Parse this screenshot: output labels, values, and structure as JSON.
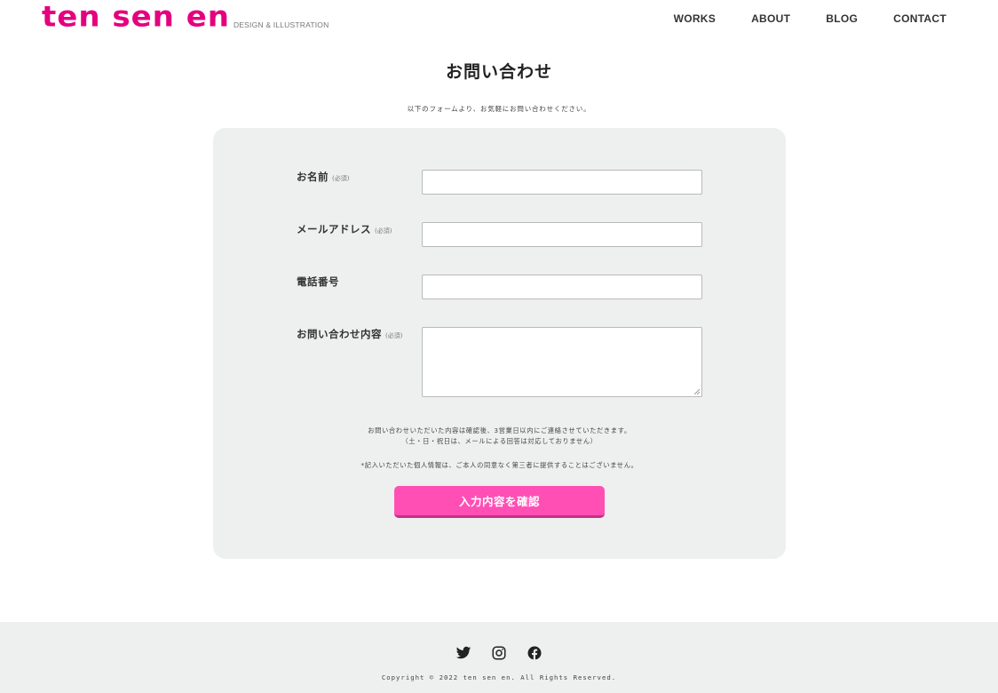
{
  "header": {
    "logo_text": "ten sen en",
    "logo_tagline": "DESIGN & ILLUSTRATION",
    "nav": [
      "WORKS",
      "ABOUT",
      "BLOG",
      "CONTACT"
    ]
  },
  "colors": {
    "brand": "#e4007f",
    "button": "#ff4fb4",
    "panel": "#eef0f0"
  },
  "page": {
    "title": "お問い合わせ",
    "lead": "以下のフォームより、お気軽にお問い合わせください。"
  },
  "form": {
    "required_mark": "(必須)",
    "fields": [
      {
        "label": "お名前",
        "required": true,
        "value": ""
      },
      {
        "label": "メールアドレス",
        "required": true,
        "value": ""
      },
      {
        "label": "電話番号",
        "required": false,
        "value": ""
      },
      {
        "label": "お問い合わせ内容",
        "required": true,
        "value": ""
      }
    ],
    "note_line1": "お問い合わせいただいた内容は確認後、3営業日以内にご連絡させていただきます。",
    "note_line2": "（土・日・祝日は、メールによる回答は対応しておりません）",
    "privacy_note": "*記入いただいた個人情報は、ご本人の同意なく第三者に提供することはございません。",
    "submit_label": "入力内容を確認"
  },
  "footer": {
    "social_icons": [
      "twitter-icon",
      "instagram-icon",
      "facebook-icon"
    ],
    "copyright": "Copyright © 2022 ten sen en. All Rights Reserved."
  }
}
